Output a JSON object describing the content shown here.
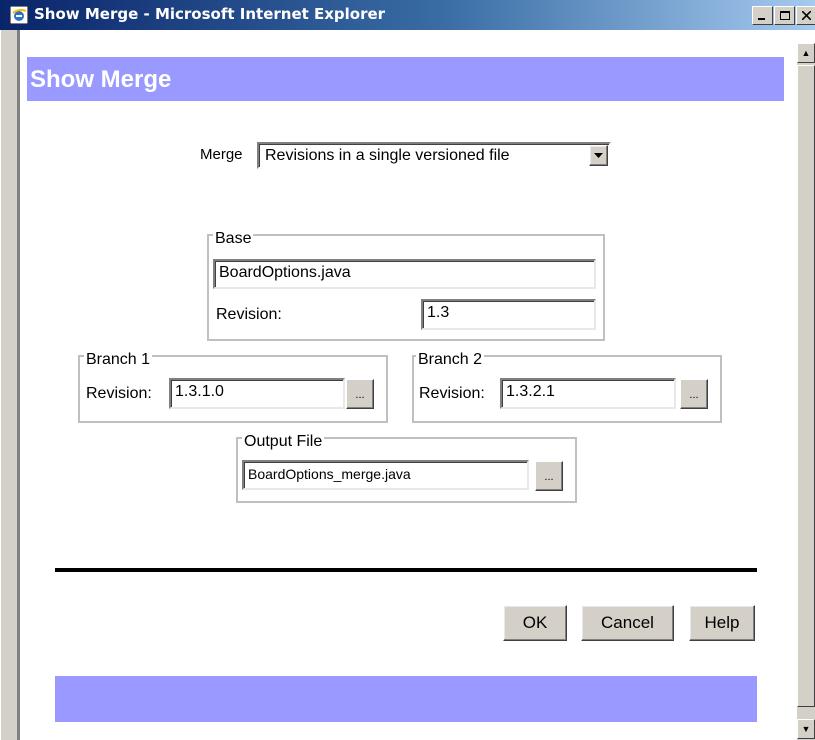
{
  "window": {
    "title": "Show Merge - Microsoft Internet Explorer"
  },
  "header": {
    "title": "Show Merge"
  },
  "merge": {
    "label": "Merge",
    "selected": "Revisions in a single versioned file"
  },
  "base": {
    "legend": "Base",
    "file": "BoardOptions.java",
    "revision_label": "Revision:",
    "revision": "1.3"
  },
  "branch1": {
    "legend": "Branch 1",
    "revision_label": "Revision:",
    "revision": "1.3.1.0",
    "browse": "..."
  },
  "branch2": {
    "legend": "Branch 2",
    "revision_label": "Revision:",
    "revision": "1.3.2.1",
    "browse": "..."
  },
  "output": {
    "legend": "Output File",
    "file": "BoardOptions_merge.java",
    "browse": "..."
  },
  "buttons": {
    "ok": "OK",
    "cancel": "Cancel",
    "help": "Help"
  },
  "colors": {
    "accent_band": "#9999ff",
    "titlebar": "#0a246a"
  }
}
